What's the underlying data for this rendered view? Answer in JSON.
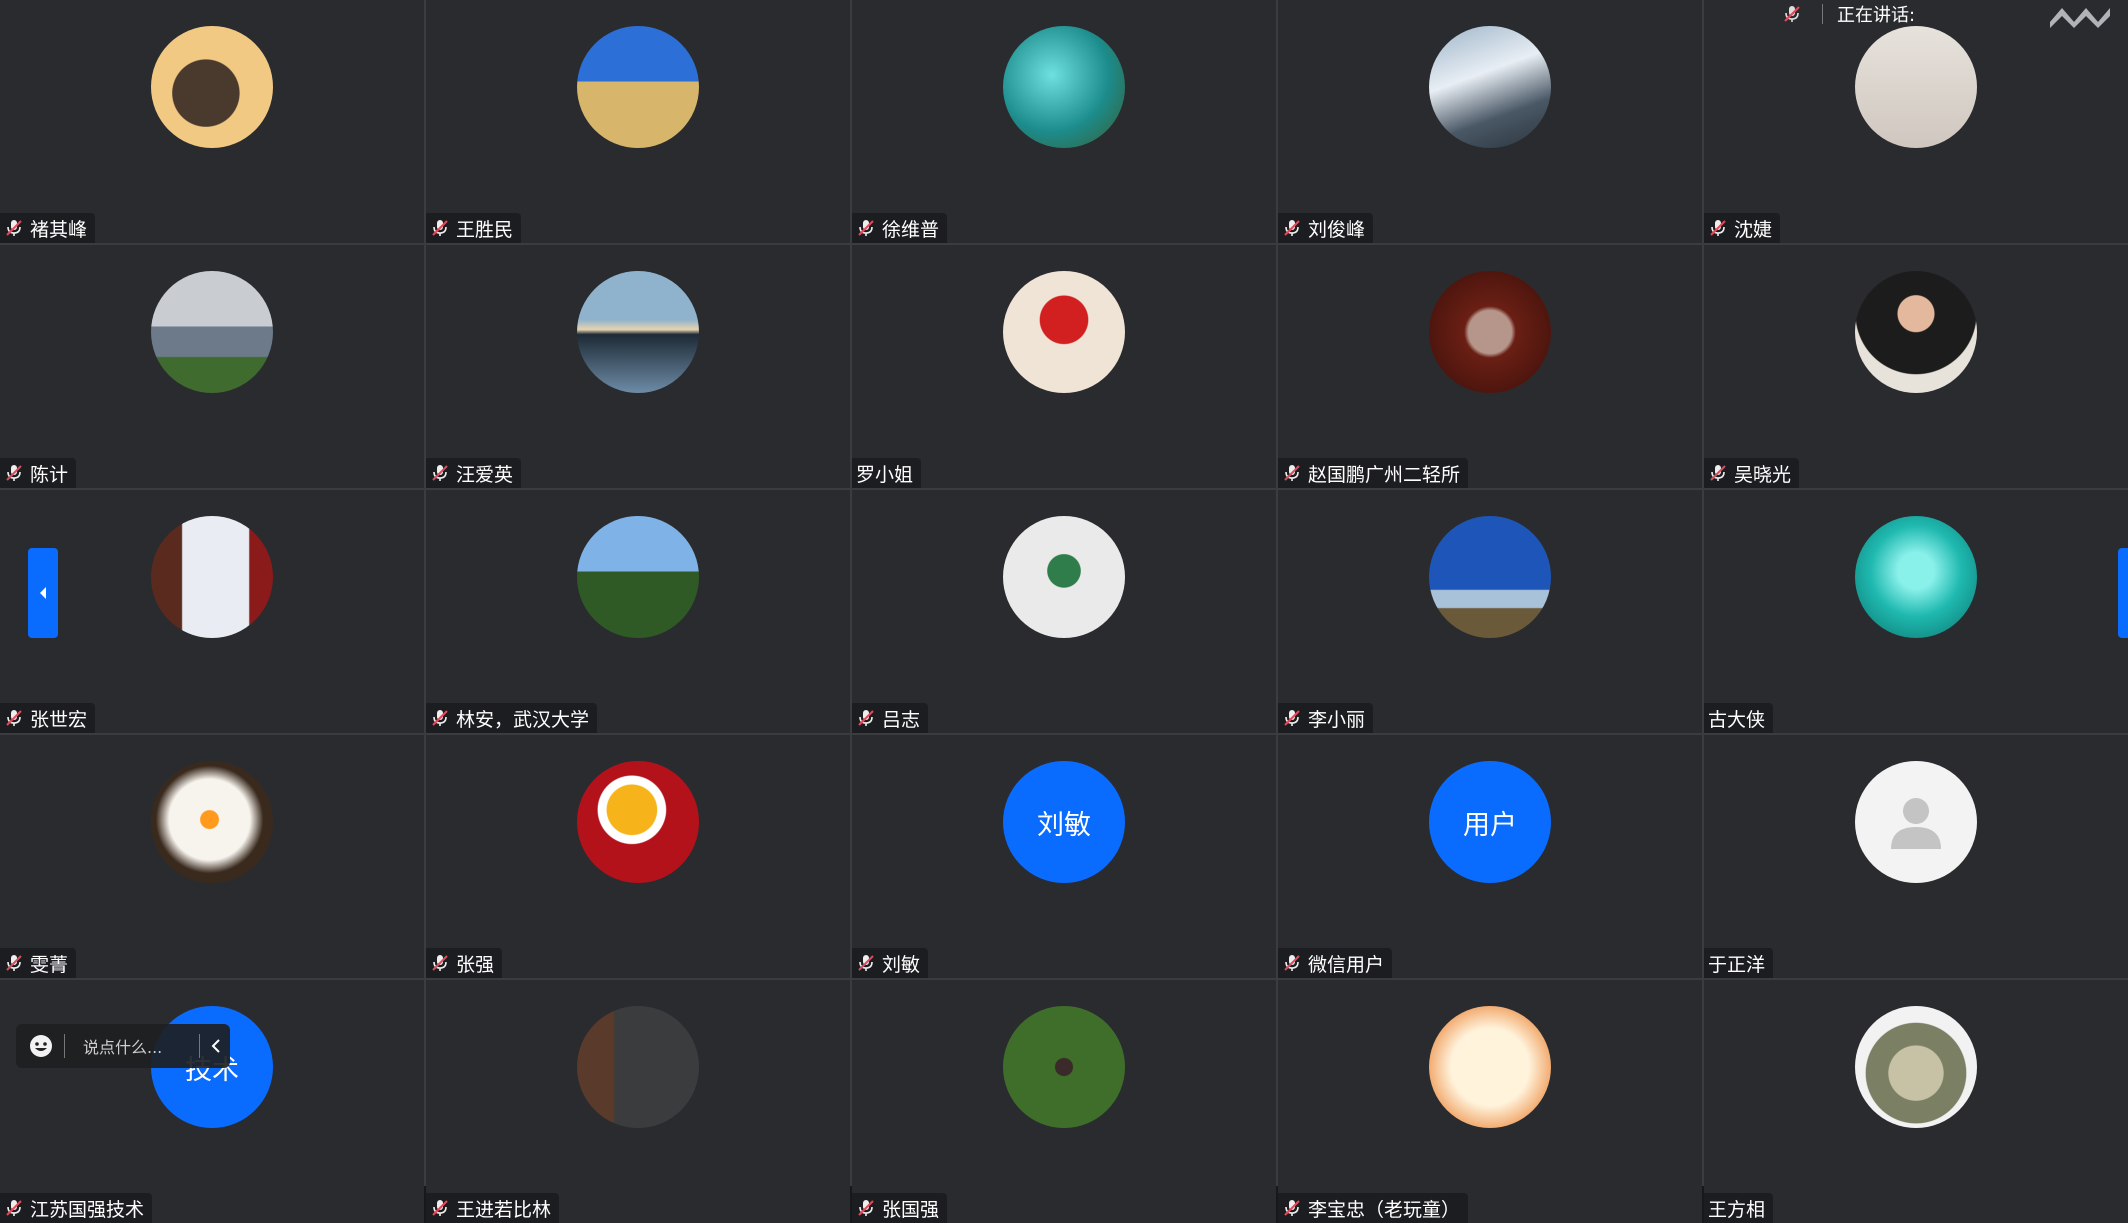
{
  "speaking": {
    "label": "正在讲话:"
  },
  "chat": {
    "placeholder": "说点什么..."
  },
  "participants": [
    {
      "name": "褚其峰",
      "muted": true,
      "avatar": "photo-couple"
    },
    {
      "name": "王胜民",
      "muted": true,
      "avatar": "photo-desert"
    },
    {
      "name": "徐维普",
      "muted": true,
      "avatar": "photo-sea"
    },
    {
      "name": "刘俊峰",
      "muted": true,
      "avatar": "photo-mountain"
    },
    {
      "name": "沈婕",
      "muted": true,
      "avatar": "photo-cat-flowers"
    },
    {
      "name": "陈计",
      "muted": true,
      "avatar": "photo-city"
    },
    {
      "name": "汪爱英",
      "muted": true,
      "avatar": "photo-lake"
    },
    {
      "name": "罗小姐",
      "muted": false,
      "avatar": "photo-red-dress"
    },
    {
      "name": "赵国鹏广州二轻所",
      "muted": true,
      "avatar": "photo-teapot"
    },
    {
      "name": "吴晓光",
      "muted": true,
      "avatar": "photo-man"
    },
    {
      "name": "张世宏",
      "muted": true,
      "avatar": "photo-presentation"
    },
    {
      "name": "林安，武汉大学",
      "muted": true,
      "avatar": "photo-trees"
    },
    {
      "name": "吕志",
      "muted": true,
      "avatar": "photo-cartoon"
    },
    {
      "name": "李小丽",
      "muted": true,
      "avatar": "photo-sky"
    },
    {
      "name": "古大侠",
      "muted": false,
      "avatar": "photo-robot"
    },
    {
      "name": "雯菁",
      "muted": true,
      "avatar": "photo-egg"
    },
    {
      "name": "张强",
      "muted": true,
      "avatar": "photo-tea"
    },
    {
      "name": "刘敏",
      "muted": true,
      "avatar_text": "刘敏"
    },
    {
      "name": "微信用户",
      "muted": true,
      "avatar_text": "用户"
    },
    {
      "name": "于正洋",
      "muted": false,
      "avatar": "default-user"
    },
    {
      "name": "江苏国强技术",
      "muted": true,
      "avatar_text": "技术"
    },
    {
      "name": "王进若比林",
      "muted": true,
      "avatar": "photo-blossom-wall"
    },
    {
      "name": "张国强",
      "muted": true,
      "avatar": "photo-garden-person"
    },
    {
      "name": "李宝忠（老玩童）",
      "muted": true,
      "avatar": "photo-calligraphy"
    },
    {
      "name": "王方相",
      "muted": false,
      "avatar": "photo-totoro"
    }
  ],
  "colors": {
    "accent": "#0a6cff",
    "tile": "#2a2b2f",
    "muted_icon": "#e04a5a"
  }
}
